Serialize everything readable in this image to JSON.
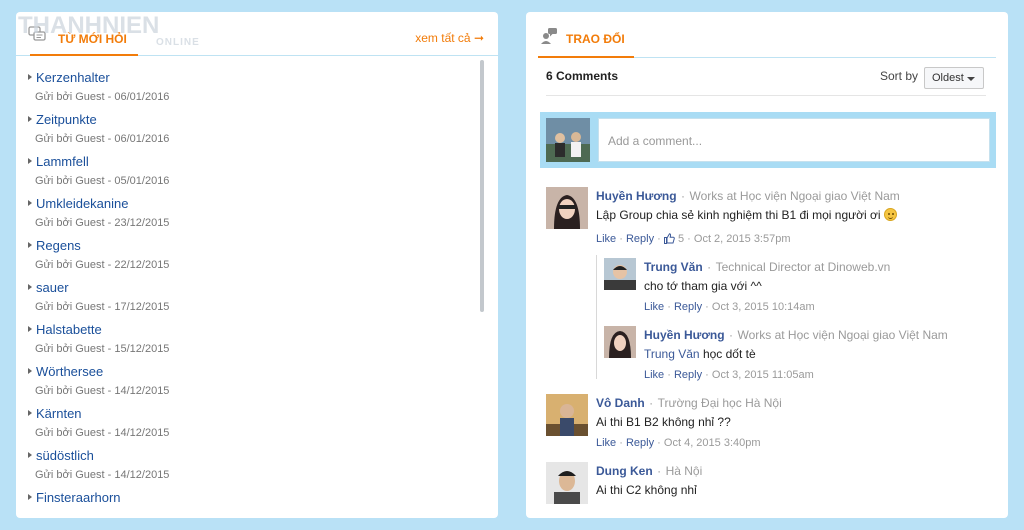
{
  "left": {
    "title": "TỪ MỚI HỎI",
    "more_label": "xem tất cả",
    "watermark": "THANHNIEN",
    "watermark_sub": "ONLINE",
    "items": [
      {
        "word": "Kerzenhalter",
        "meta": "Gửi bởi Guest - 06/01/2016"
      },
      {
        "word": "Zeitpunkte",
        "meta": "Gửi bởi Guest - 06/01/2016"
      },
      {
        "word": "Lammfell",
        "meta": "Gửi bởi Guest - 05/01/2016"
      },
      {
        "word": "Umkleidekanine",
        "meta": "Gửi bởi Guest - 23/12/2015"
      },
      {
        "word": "Regens",
        "meta": "Gửi bởi Guest - 22/12/2015"
      },
      {
        "word": "sauer",
        "meta": "Gửi bởi Guest - 17/12/2015"
      },
      {
        "word": "Halstabette",
        "meta": "Gửi bởi Guest - 15/12/2015"
      },
      {
        "word": "Wörthersee",
        "meta": "Gửi bởi Guest - 14/12/2015"
      },
      {
        "word": "Kärnten",
        "meta": "Gửi bởi Guest - 14/12/2015"
      },
      {
        "word": "südöstlich",
        "meta": "Gửi bởi Guest - 14/12/2015"
      },
      {
        "word": "Finsteraarhorn",
        "meta": ""
      }
    ]
  },
  "right": {
    "title": "TRAO ĐỔI",
    "comment_count": "6 Comments",
    "sort_label": "Sort by",
    "sort_value": "Oldest",
    "input_placeholder": "Add a comment...",
    "like": "Like",
    "reply": "Reply",
    "dot": "·",
    "comments": [
      {
        "name": "Huyền Hương",
        "sub": "Works at Học viện Ngoại giao Việt Nam",
        "text": "Lập Group chia sẻ kinh nghiệm thi B1 đi mọi người ơi",
        "likes": "5",
        "time": "Oct 2, 2015 3:57pm"
      },
      {
        "name": "Trung Văn",
        "sub": "Technical Director at Dinoweb.vn",
        "text": "cho tớ tham gia với ^^",
        "time": "Oct 3, 2015 10:14am"
      },
      {
        "name": "Huyền Hương",
        "sub": "Works at Học viện Ngoại giao Việt Nam",
        "mention": "Trung Văn",
        "text": "học dốt tè",
        "time": "Oct 3, 2015 11:05am"
      },
      {
        "name": "Vô Danh",
        "sub": "Trường Đại học Hà Nội",
        "text": "Ai thi B1 B2 không nhỉ ??",
        "time": "Oct 4, 2015 3:40pm"
      },
      {
        "name": "Dung Ken",
        "sub": "Hà Nội",
        "text": "Ai thi C2 không nhỉ"
      }
    ]
  },
  "colors": {
    "accent": "#f27c0a",
    "link": "#1a4f9a",
    "fb_blue": "#3b5998",
    "frame": "#b9e1f6"
  }
}
